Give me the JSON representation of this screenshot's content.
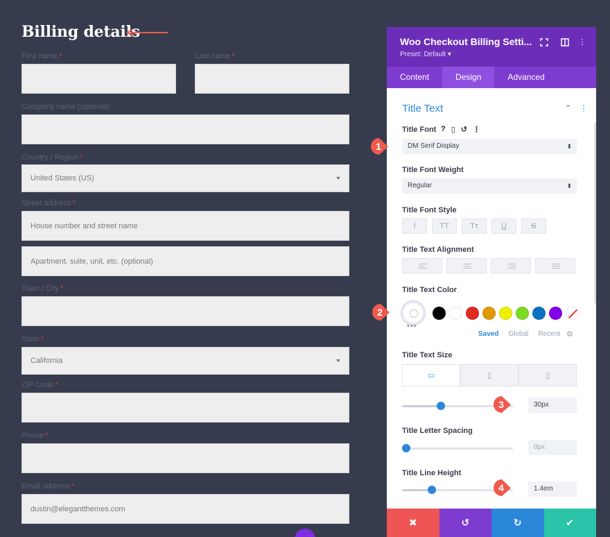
{
  "billing": {
    "title": "Billing details",
    "fields": {
      "first_name": {
        "label": "First name"
      },
      "last_name": {
        "label": "Last name"
      },
      "company": {
        "label": "Company name (optional)"
      },
      "country": {
        "label": "Country / Region",
        "value": "United States (US)"
      },
      "street": {
        "label": "Street address",
        "placeholder1": "House number and street name",
        "placeholder2": "Apartment, suite, unit, etc. (optional)"
      },
      "town": {
        "label": "Town / City"
      },
      "state": {
        "label": "State",
        "value": "California"
      },
      "zip": {
        "label": "ZIP Code"
      },
      "phone": {
        "label": "Phone"
      },
      "email": {
        "label": "Email address",
        "value": "dustin@elegantthemes.com"
      }
    },
    "required_mark": "*"
  },
  "panel": {
    "title": "Woo Checkout Billing Setti...",
    "preset": "Preset: Default ▾",
    "tabs": [
      "Content",
      "Design",
      "Advanced"
    ],
    "active_tab": "Design",
    "section": "Title Text",
    "title_font": {
      "label": "Title Font",
      "value": "DM Serif Display",
      "icons": [
        "?",
        "▯",
        "↺",
        "⋮"
      ]
    },
    "title_font_weight": {
      "label": "Title Font Weight",
      "value": "Regular"
    },
    "title_font_style": {
      "label": "Title Font Style",
      "buttons": [
        "I",
        "TT",
        "Tт",
        "U",
        "S"
      ]
    },
    "title_text_alignment": {
      "label": "Title Text Alignment"
    },
    "title_text_color": {
      "label": "Title Text Color",
      "swatches": [
        "#000000",
        "#ffffff",
        "#e02b20",
        "#e09900",
        "#edf000",
        "#7cda24",
        "#0c71c3",
        "#8300e9"
      ],
      "palette_tabs": [
        "Saved",
        "Global",
        "Recent"
      ],
      "more": "•••"
    },
    "title_text_size": {
      "label": "Title Text Size",
      "value": "30px",
      "slider_fraction": 0.31
    },
    "title_letter_spacing": {
      "label": "Title Letter Spacing",
      "value": "0px",
      "slider_fraction": 0.0
    },
    "title_line_height": {
      "label": "Title Line Height",
      "value": "1.4em",
      "slider_fraction": 0.23
    },
    "footer": {
      "buttons": [
        {
          "name": "cancel",
          "glyph": "✖",
          "color": "#ef5555"
        },
        {
          "name": "undo",
          "glyph": "↺",
          "color": "#7e3bd0"
        },
        {
          "name": "redo",
          "glyph": "↻",
          "color": "#2b87da"
        },
        {
          "name": "save",
          "glyph": "✔",
          "color": "#29c4a9"
        }
      ]
    }
  },
  "callouts": [
    "1",
    "2",
    "3",
    "4"
  ],
  "colors": {
    "background": "#363c4d",
    "panel_header": "#6c2eb9",
    "accent": "#2b87da",
    "callout": "#ef5a4c"
  }
}
